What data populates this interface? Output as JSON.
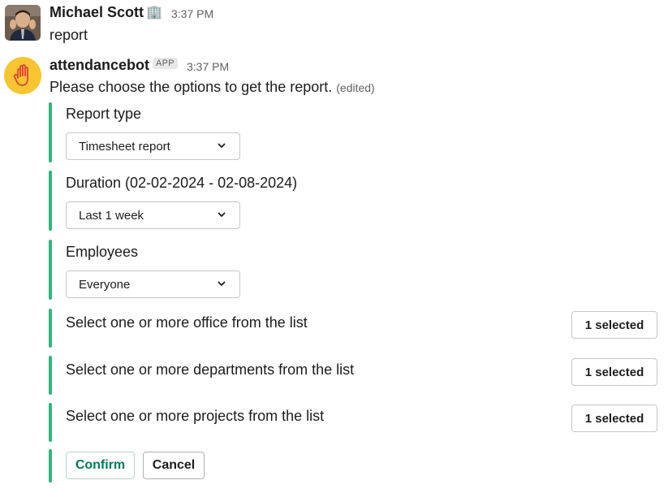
{
  "messages": [
    {
      "author": "Michael Scott",
      "status_emoji": "🏢",
      "time": "3:37 PM",
      "text": "report"
    },
    {
      "author": "attendancebot",
      "badge": "APP",
      "time": "3:37 PM",
      "text": "Please choose the options to get the report.",
      "edited": "(edited)"
    }
  ],
  "form": {
    "report_type": {
      "label": "Report type",
      "value": "Timesheet report"
    },
    "duration": {
      "label": "Duration (02-02-2024 - 02-08-2024)",
      "value": "Last 1 week"
    },
    "employees": {
      "label": "Employees",
      "value": "Everyone"
    },
    "offices": {
      "label": "Select one or more office from the list",
      "button": "1 selected"
    },
    "departments": {
      "label": "Select one or more departments from the list",
      "button": "1 selected"
    },
    "projects": {
      "label": "Select one or more projects from the list",
      "button": "1 selected"
    },
    "confirm_label": "Confirm",
    "cancel_label": "Cancel"
  },
  "colors": {
    "accent_bar": "#2eb67d",
    "confirm_text": "#007a5a",
    "bot_avatar_bg": "#f6c531",
    "hand_icon": "#e3413a"
  },
  "icons": {
    "bot_avatar": "raised-hand-icon",
    "user_avatar": "user-photo",
    "dropdown": "chevron-down-icon"
  }
}
